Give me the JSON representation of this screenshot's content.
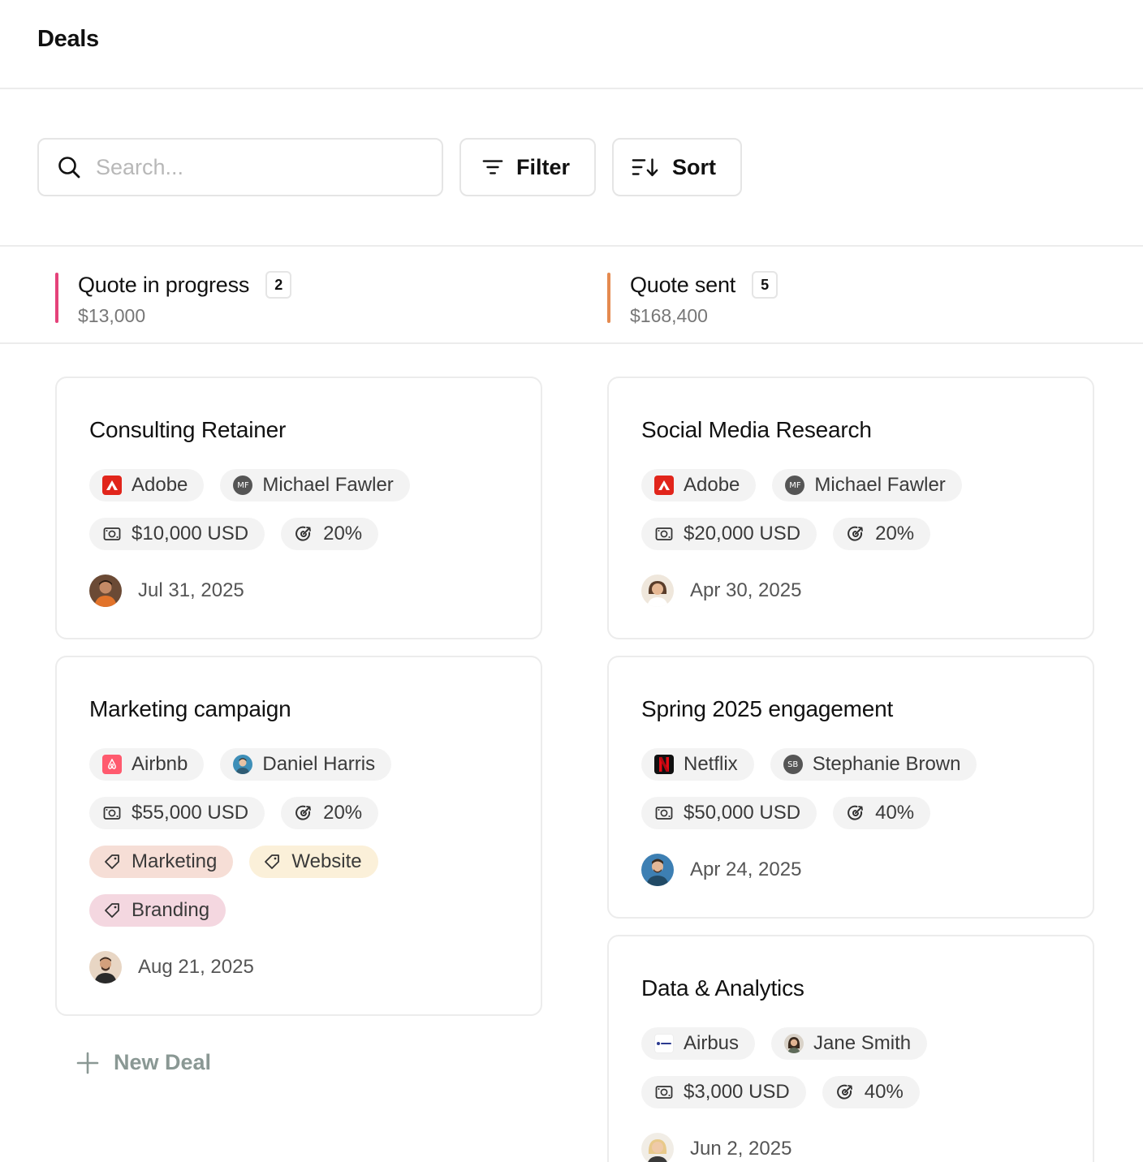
{
  "header": {
    "title": "Deals"
  },
  "toolbar": {
    "search_placeholder": "Search...",
    "filter_label": "Filter",
    "sort_label": "Sort"
  },
  "columns": [
    {
      "title": "Quote in progress",
      "count": "2",
      "amount": "$13,000",
      "color": "#e5427a",
      "cards": [
        {
          "title": "Consulting Retainer",
          "company": "Adobe",
          "owner": "Michael Fawler",
          "owner_initials": "MF",
          "value": "$10,000 USD",
          "probability": "20%",
          "date": "Jul 31, 2025"
        },
        {
          "title": "Marketing campaign",
          "company": "Airbnb",
          "owner": "Daniel Harris",
          "value": "$55,000 USD",
          "probability": "20%",
          "tags": [
            "Marketing",
            "Website",
            "Branding"
          ],
          "date": "Aug 21, 2025"
        }
      ],
      "new_deal_label": "New Deal"
    },
    {
      "title": "Quote sent",
      "count": "5",
      "amount": "$168,400",
      "color": "#e58a4f",
      "cards": [
        {
          "title": "Social Media Research",
          "company": "Adobe",
          "owner": "Michael Fawler",
          "owner_initials": "MF",
          "value": "$20,000 USD",
          "probability": "20%",
          "date": "Apr 30, 2025"
        },
        {
          "title": "Spring 2025 engagement",
          "company": "Netflix",
          "owner": "Stephanie Brown",
          "owner_initials": "SB",
          "value": "$50,000 USD",
          "probability": "40%",
          "date": "Apr 24, 2025"
        },
        {
          "title": "Data & Analytics",
          "company": "Airbus",
          "owner": "Jane Smith",
          "value": "$3,000 USD",
          "probability": "40%",
          "date": "Jun 2, 2025"
        }
      ]
    }
  ],
  "icons": {
    "search": "search-icon",
    "filter": "filter-icon",
    "sort": "sort-icon",
    "money": "money-icon",
    "probability": "probability-icon",
    "tag": "tag-icon",
    "plus": "plus-icon"
  }
}
